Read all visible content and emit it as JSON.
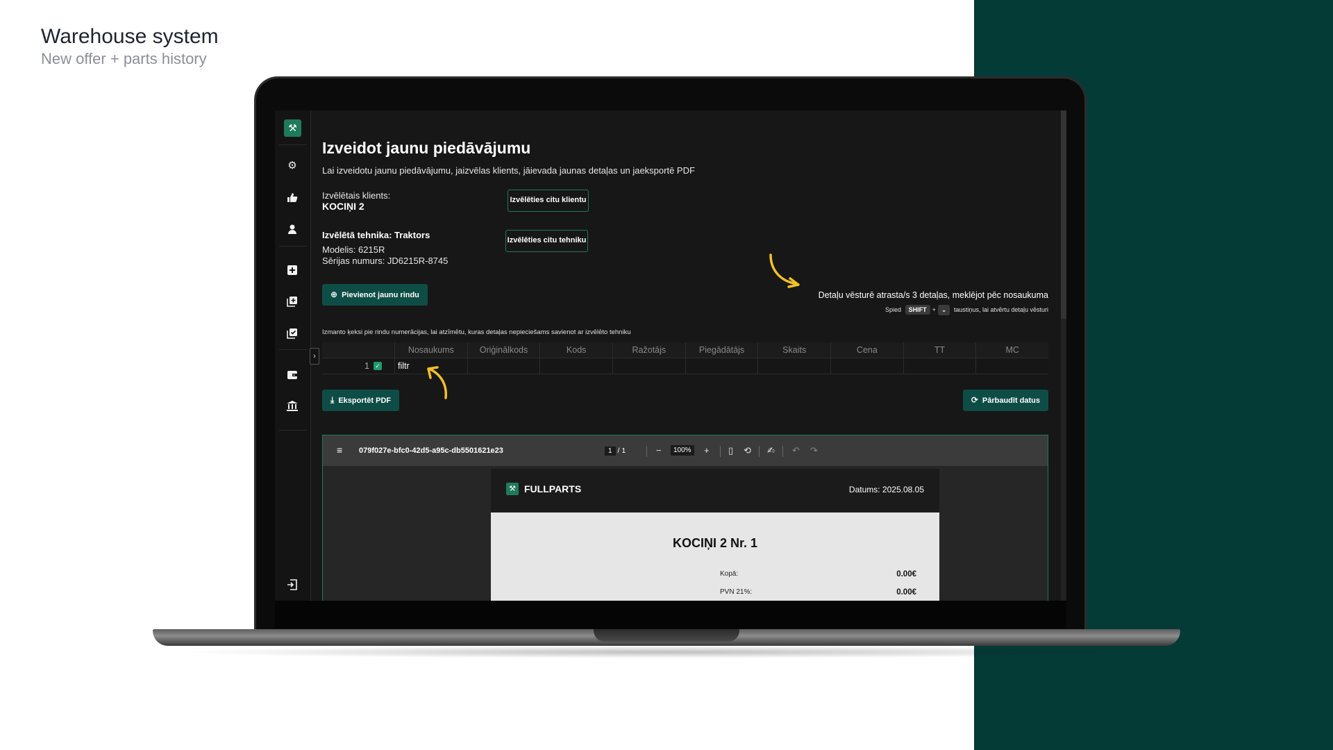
{
  "caption": {
    "title": "Warehouse system",
    "subtitle": "New offer + parts history"
  },
  "colors": {
    "accent_green": "#1f7a5c",
    "panel_green": "#053b37",
    "button_green": "#0e4d45",
    "annotation_yellow": "#f2c029"
  },
  "sidebar": {
    "logo_icon": "wrench-logo-icon",
    "items": [
      {
        "icon": "gear-icon"
      },
      {
        "icon": "thumbs-icon"
      },
      {
        "icon": "user-icon"
      },
      {
        "icon": "plus-square-icon"
      },
      {
        "icon": "copy-plus-icon"
      },
      {
        "icon": "checklist-icon"
      },
      {
        "icon": "wallet-icon"
      },
      {
        "icon": "bank-icon"
      },
      {
        "icon": "logout-icon"
      }
    ],
    "collapse_icon": "chevron-right-icon"
  },
  "main": {
    "title": "Izveidot jaunu piedāvājumu",
    "description": "Lai izveidotu jaunu piedāvājumu, jaizvēlas klients, jāievada jaunas detaļas un jaeksportē PDF",
    "client": {
      "label": "Izvēlētais klients:",
      "name": "KOCIŅI 2",
      "change_button": "Izvēlēties citu klientu"
    },
    "tech": {
      "label": "Izvēlētā tehnika: Traktors",
      "model": "Modelis: 6215R",
      "serial": "Sērijas numurs: JD6215R-8745",
      "change_button": "Izvēlēties citu tehniku"
    },
    "add_row_button": "Pievienot jaunu rindu",
    "history_message": "Detaļu vēsturē atrasta/s 3 detaļas, meklējot pēc nosaukuma",
    "hint": {
      "prefix": "Spied",
      "key1": "SHIFT",
      "plus": "+",
      "key2": "⌄",
      "suffix": "taustiņus, lai atvērtu detaļu vēsturi"
    },
    "table_note": "Izmanto ķeksi pie rindu numerācijas, lai atzīmētu, kuras detaļas nepieciešams savienot ar izvēlēto tehniku",
    "table": {
      "headers": [
        "Nosaukums",
        "Oriģinālkods",
        "Kods",
        "Ražotājs",
        "Piegādātājs",
        "Skaits",
        "Cena",
        "TT",
        "MC"
      ],
      "rows": [
        {
          "index": "1",
          "checked": true,
          "cells": [
            "filtr",
            "",
            "",
            "",
            "",
            "",
            "",
            "",
            ""
          ]
        }
      ]
    },
    "export_button": "Eksportēt PDF",
    "validate_button": "Pārbaudīt datus"
  },
  "pdf_viewer": {
    "filename": "079f027e-bfc0-42d5-a95c-db5501621e23",
    "current_page": "1",
    "separator": "/",
    "total_pages": "1",
    "zoom": "100%",
    "document": {
      "brand": "FULLPARTS",
      "date": "Datums: 2025.08.05",
      "title": "KOCIŅI 2 Nr. 1",
      "total_label": "Kopā:",
      "total_value": "0.00€",
      "vat_label": "PVN 21%:",
      "vat_value": "0.00€"
    }
  }
}
